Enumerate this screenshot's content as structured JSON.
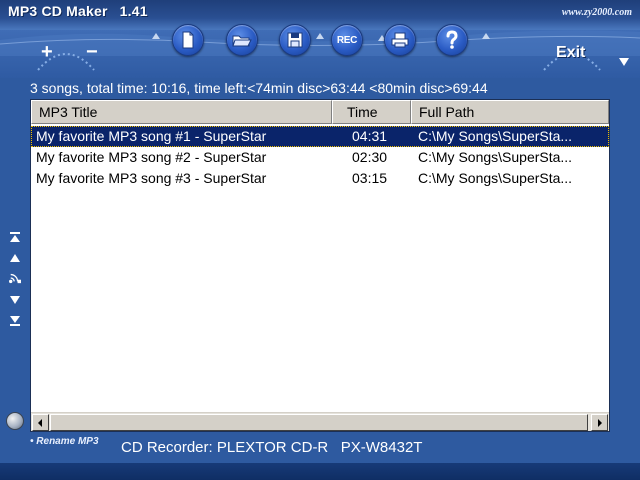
{
  "app": {
    "title": "MP3 CD Maker",
    "version": "1.41",
    "website": "www.zy2000.com"
  },
  "toolbar": {
    "add_label": "+",
    "remove_label": "−",
    "rec_label": "REC",
    "exit_label": "Exit",
    "buttons": [
      {
        "name": "new-icon"
      },
      {
        "name": "open-folder-icon"
      },
      {
        "name": "save-icon"
      },
      {
        "name": "rec-icon"
      },
      {
        "name": "printer-icon"
      },
      {
        "name": "help-icon"
      }
    ]
  },
  "info_line": "3 songs, total time: 10:16, time left:<74min disc>63:44 <80min disc>69:44",
  "list": {
    "columns": [
      "MP3 Title",
      "Time",
      "Full Path"
    ],
    "rows": [
      {
        "title": "My favorite MP3 song #1 - SuperStar",
        "time": "04:31",
        "path": "C:\\My Songs\\SuperSta...",
        "selected": true
      },
      {
        "title": "My favorite MP3 song #2 - SuperStar",
        "time": "02:30",
        "path": "C:\\My Songs\\SuperSta...",
        "selected": false
      },
      {
        "title": "My favorite MP3 song #3 - SuperStar",
        "time": "03:15",
        "path": "C:\\My Songs\\SuperSta...",
        "selected": false
      }
    ]
  },
  "nav_buttons": [
    "move-top-icon",
    "move-up-icon",
    "play-icon",
    "move-down-icon",
    "move-bottom-icon"
  ],
  "footer": {
    "rename_link": "• Rename MP3",
    "recorder": "CD Recorder: PLEXTOR CD-R   PX-W8432T"
  },
  "colors": {
    "background": "#2e5aa0",
    "selection": "#0a246a",
    "header_gray": "#d4d0c8"
  }
}
